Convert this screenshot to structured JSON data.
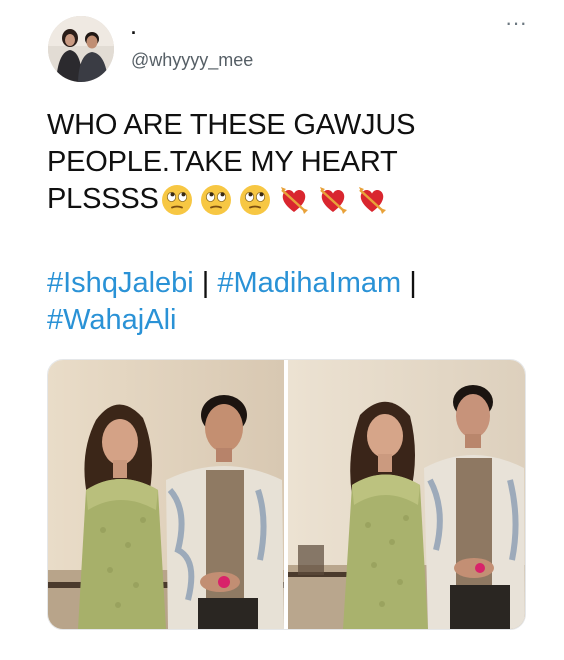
{
  "user": {
    "display_name": ".",
    "handle": "@whyyyy_mee"
  },
  "menu": {
    "more_label": "···"
  },
  "tweet": {
    "lines": [
      "WHO ARE THESE GAWJUS",
      "PEOPLE.TAKE MY HEART",
      "PLSSSS"
    ],
    "emojis": [
      "face-with-rolling-eyes-icon",
      "face-with-rolling-eyes-icon",
      "face-with-rolling-eyes-icon",
      "heart-with-arrow-icon",
      "heart-with-arrow-icon",
      "heart-with-arrow-icon"
    ],
    "hashtags": [
      "#IshqJalebi",
      "#MadihaImam",
      "#WahajAli"
    ],
    "separator": "|"
  },
  "media": {
    "photo_count": 2
  },
  "colors": {
    "link": "#2a92d6",
    "text": "#101010",
    "secondary": "#565f66"
  }
}
